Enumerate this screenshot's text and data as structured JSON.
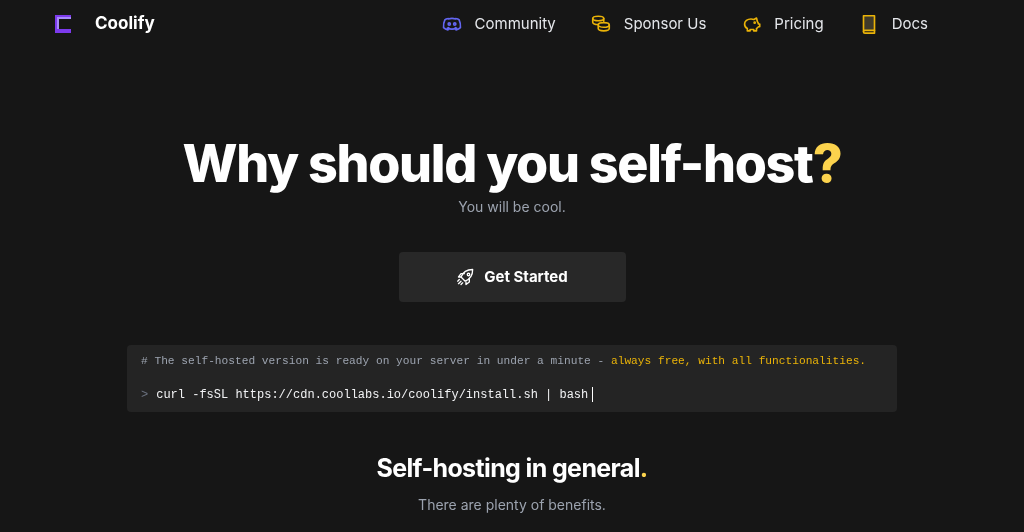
{
  "header": {
    "brand": "Coolify",
    "nav": [
      {
        "kind": "discord",
        "label": "Community"
      },
      {
        "kind": "coins",
        "label": "Sponsor Us"
      },
      {
        "kind": "piggy",
        "label": "Pricing"
      },
      {
        "kind": "book",
        "label": "Docs"
      }
    ]
  },
  "hero": {
    "title": "Why should you self-host",
    "title_mark": "?",
    "subtitle": "You will be cool.",
    "button": "Get Started"
  },
  "code": {
    "comment": "# The self-hosted version is ready on your server in under a minute - ",
    "comment_highlight": "always free, with all functionalities.",
    "prompt": ">",
    "command": "curl -fsSL https://cdn.coollabs.io/coolify/install.sh | bash"
  },
  "section": {
    "title": "Self-hosting in general",
    "title_mark": ".",
    "subtitle": "There are plenty of benefits."
  }
}
